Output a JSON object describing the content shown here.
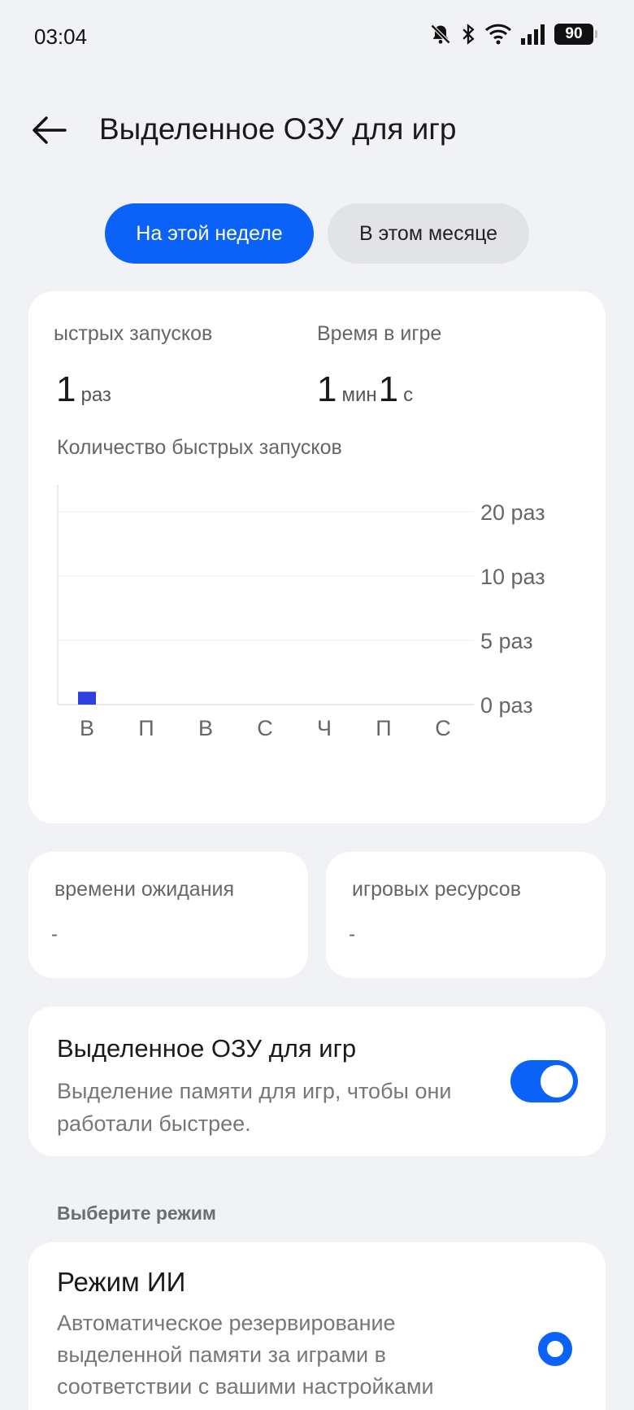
{
  "status_bar": {
    "time": "03:04",
    "battery": "90",
    "icons": [
      "mute-bell-icon",
      "bluetooth-icon",
      "wifi-icon",
      "signal-icon",
      "battery-icon"
    ]
  },
  "header": {
    "title": "Выделенное ОЗУ для игр",
    "back_icon": "arrow-left-icon"
  },
  "tabs": [
    {
      "label": "На этой неделе",
      "active": true
    },
    {
      "label": "В этом месяце",
      "active": false
    }
  ],
  "stats": {
    "launches": {
      "label": "ыстрых запусков",
      "value": "1",
      "unit": "раз"
    },
    "playtime": {
      "label": "Время в игре",
      "value1": "1",
      "unit1": "мин",
      "value2": "1",
      "unit2": "с"
    }
  },
  "chart_data": {
    "type": "bar",
    "title": "Количество быстрых запусков",
    "categories": [
      "В",
      "П",
      "В",
      "С",
      "Ч",
      "П",
      "С"
    ],
    "values": [
      1,
      0,
      0,
      0,
      0,
      0,
      0
    ],
    "y_ticks": [
      {
        "value": 0,
        "label": "0 раз"
      },
      {
        "value": 5,
        "label": "5 раз"
      },
      {
        "value": 10,
        "label": "10 раз"
      },
      {
        "value": 20,
        "label": "20 раз"
      }
    ],
    "y_scale": "piecewise (ticks equally spaced)",
    "bar_color": "#2f3fe0",
    "grid": true
  },
  "info_cards": [
    {
      "label": "времени ожидания",
      "value": "-"
    },
    {
      "label": "игровых ресурсов",
      "value": "-"
    }
  ],
  "toggle_setting": {
    "title": "Выделенное ОЗУ для игр",
    "description": "Выделение памяти для игр, чтобы они работали быстрее.",
    "enabled": true
  },
  "mode_section": {
    "label": "Выберите режим",
    "modes": [
      {
        "title": "Режим ИИ",
        "description": "Автоматическое резервирование выделенной памяти за играми в соответствии с вашими настройками",
        "selected": true
      }
    ]
  },
  "colors": {
    "accent": "#0a62f8",
    "background": "#f1f2f5",
    "card": "#ffffff"
  }
}
